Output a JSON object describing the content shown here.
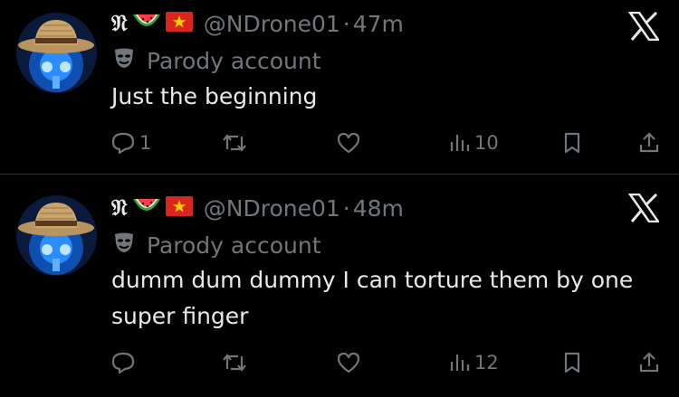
{
  "tweets": [
    {
      "display_name": "𝔑",
      "handle": "@NDrone01",
      "separator": "·",
      "time": "47m",
      "badge": "Parody account",
      "text": "Just the beginning",
      "replies": "1",
      "reposts": "",
      "likes": "",
      "views": "10"
    },
    {
      "display_name": "𝔑",
      "handle": "@NDrone01",
      "separator": "·",
      "time": "48m",
      "badge": "Parody account",
      "text": "dumm dum dummy I can torture them by one super finger",
      "replies": "",
      "reposts": "",
      "likes": "",
      "views": "12"
    }
  ],
  "icons": [
    "avatar",
    "watermelon-icon",
    "vietnam-flag-icon",
    "parody-mask-icon",
    "x-logo-icon",
    "reply-icon",
    "repost-icon",
    "like-icon",
    "views-icon",
    "bookmark-icon",
    "share-icon"
  ],
  "colors": {
    "background": "#000000",
    "text": "#e7e9ea",
    "muted": "#71767b",
    "divider": "#2f3336"
  }
}
